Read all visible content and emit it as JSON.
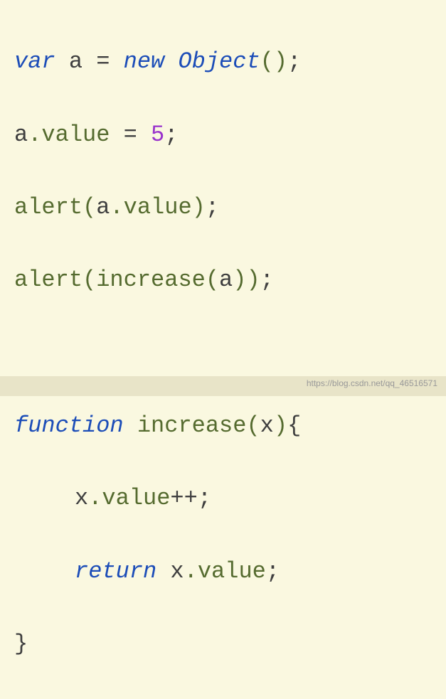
{
  "code": {
    "line1": {
      "var": "var",
      "a": "a",
      "equals": " = ",
      "new": "new",
      "object": "Object",
      "parens": "()",
      "semi": ";"
    },
    "line2": {
      "a": "a",
      "dot": ".",
      "value": "value",
      "equals": " = ",
      "num": "5",
      "semi": ";"
    },
    "line3": {
      "alert": "alert",
      "lparen": "(",
      "a": "a",
      "dot": ".",
      "value": "value",
      "rparen": ")",
      "semi": ";"
    },
    "line4": {
      "alert": "alert",
      "lparen": "(",
      "increase": "increase",
      "lparen2": "(",
      "a": "a",
      "rparen2": ")",
      "rparen": ")",
      "semi": ";"
    },
    "line6": {
      "function": "function",
      "space": " ",
      "increase": "increase",
      "lparen": "(",
      "x": "x",
      "rparen": ")",
      "lbrace": "{"
    },
    "line7": {
      "x": "x",
      "dot": ".",
      "value": "value",
      "plusplus": "++",
      "semi": ";"
    },
    "line8": {
      "return": "return",
      "space": " ",
      "x": "x",
      "dot": ".",
      "value": "value",
      "semi": ";"
    },
    "line9": {
      "rbrace": "}"
    }
  },
  "watermark": "https://blog.csdn.net/qq_46516571"
}
